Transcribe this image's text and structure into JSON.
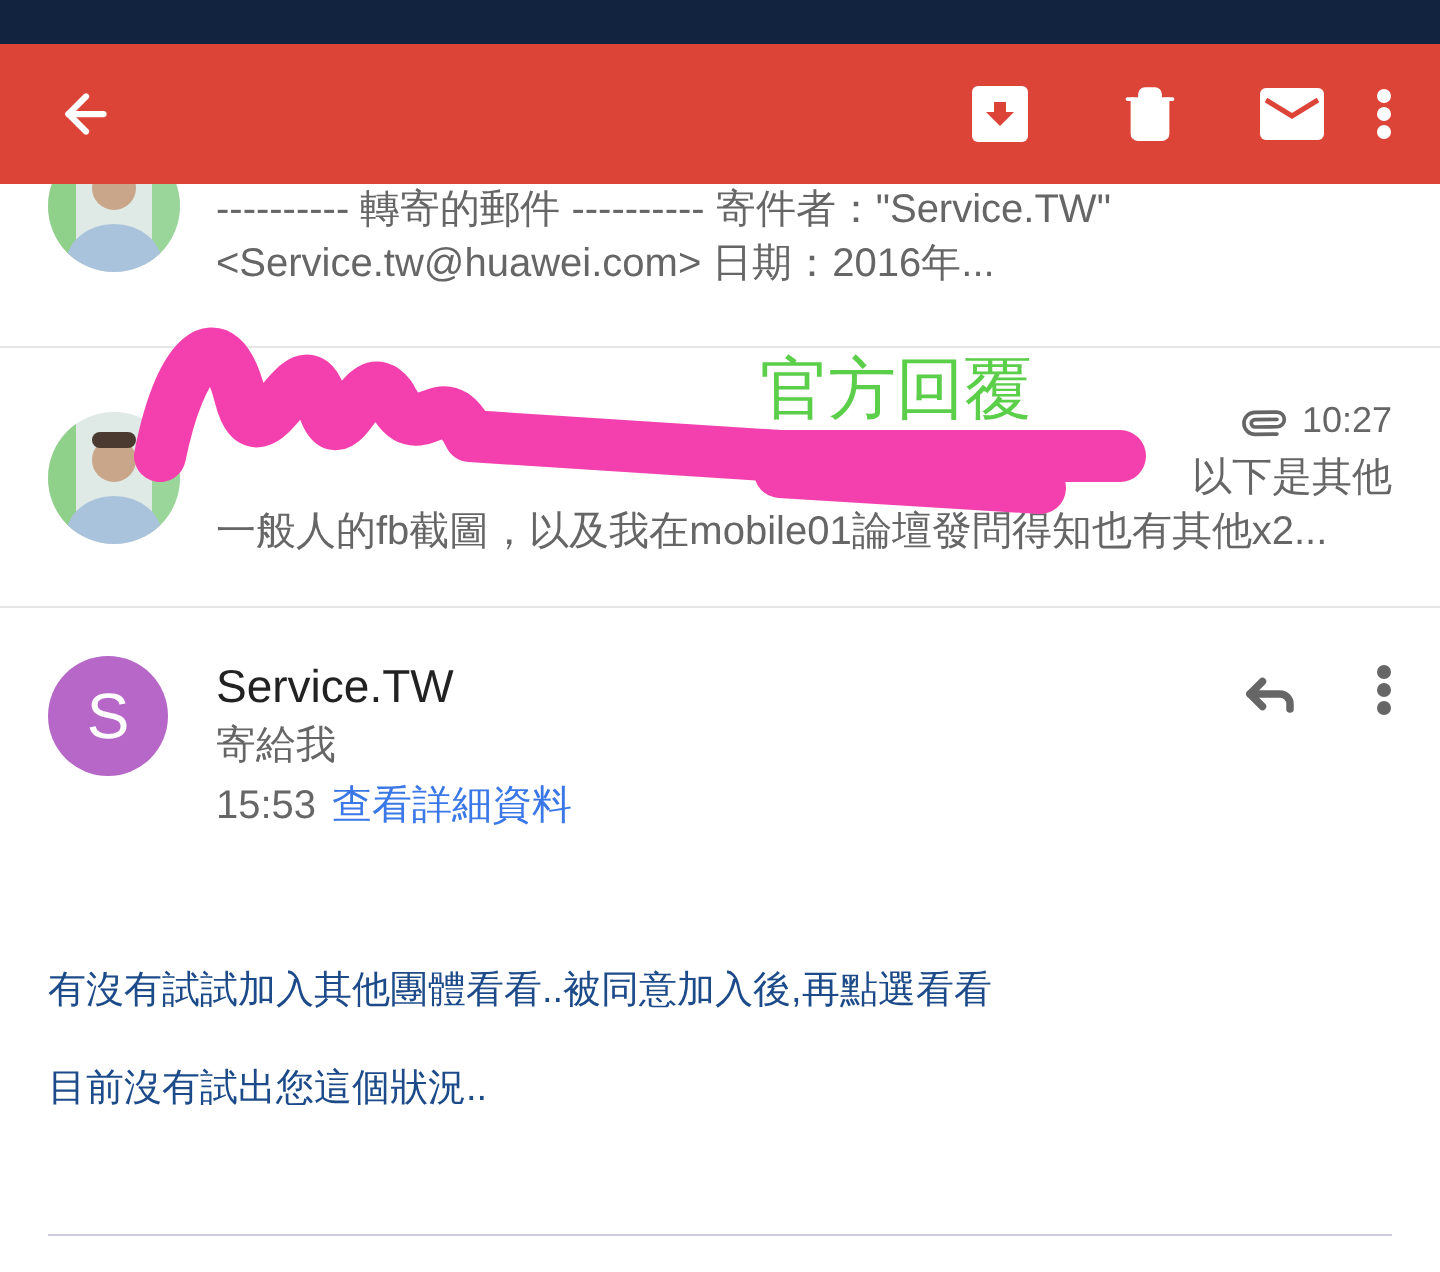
{
  "threads": [
    {
      "preview_lines": [
        "---------- 轉寄的郵件 ---------- 寄件者：\"Service.TW\"",
        "<Service.tw@huawei.com> 日期：2016年..."
      ]
    },
    {
      "time": "10:27",
      "has_attachment": true,
      "preview_lines": [
        "以下是其他",
        "一般人的fb截圖，以及我在mobile01論壇發問得知也有其他x2..."
      ]
    }
  ],
  "annotation": {
    "text": "官方回覆"
  },
  "message": {
    "avatar_letter": "S",
    "sender": "Service.TW",
    "recipient": "寄給我",
    "time": "15:53",
    "details_link": "查看詳細資料",
    "body": [
      "有沒有試試加入其他團體看看..被同意加入後,再點選看看",
      "目前沒有試出您這個狀況.."
    ]
  }
}
